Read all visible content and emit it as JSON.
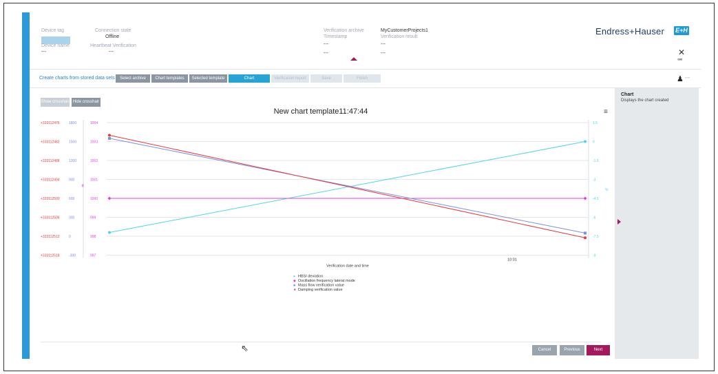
{
  "header": {
    "device_tag_label": "Device tag",
    "device_name_label": "Device name",
    "device_name_value": "---",
    "connection_state_label": "Connection state",
    "connection_state_value": "Offline",
    "heartbeat_label": "Heartbeat Verification",
    "heartbeat_value": "---",
    "verification_archive_label": "Verification archive",
    "verification_archive_value": "MyCustomerProjects1",
    "timestamp_label": "Timestamp",
    "timestamp_value": "---",
    "verification_result_label": "Verification result",
    "verification_result_value": "---",
    "extra_value_1": "---",
    "extra_value_2": "---",
    "brand": "Endress+Hauser",
    "brand_logo": "E+H"
  },
  "wizard": {
    "title": "Create charts from stored data sets",
    "steps": [
      {
        "label": "Select archive",
        "state": "done"
      },
      {
        "label": "Chart templates",
        "state": "done"
      },
      {
        "label": "Selected template",
        "state": "done"
      },
      {
        "label": "Chart",
        "state": "active"
      },
      {
        "label": "Verification report",
        "state": "todo"
      },
      {
        "label": "Save",
        "state": "todo"
      },
      {
        "label": "Finish",
        "state": "todo"
      }
    ],
    "user_dots": "---"
  },
  "toolbar": {
    "show_crosshair": "Show crosshair",
    "hide_crosshair": "Hide crosshair"
  },
  "side_panel": {
    "title": "Chart",
    "description": "Displays the chart created"
  },
  "footer": {
    "cancel": "Cancel",
    "previous": "Previous",
    "next": "Next"
  },
  "colors": {
    "accent_blue": "#2c9ad8",
    "brand_magenta": "#a3195b",
    "series_cyan": "#4fd6e6",
    "series_magenta": "#e040e0",
    "series_blue": "#7b8fe0",
    "series_red": "#e8383e"
  },
  "chart_data": {
    "type": "line",
    "title": "New chart template11:47:44",
    "xlabel": "Verification date and time",
    "x_tick_label": "10:01",
    "axes": [
      {
        "side": "left",
        "color": "#e8383e",
        "ticks": [
          "+333112476",
          "+333112482",
          "+333112488",
          "+333112494",
          "+333112500",
          "+333112506",
          "+333112512",
          "+333112518"
        ]
      },
      {
        "side": "left",
        "color": "#7b8fe0",
        "label": "ft",
        "ticks": [
          "1800",
          "1500",
          "1200",
          "900",
          "600",
          "300",
          "0",
          "-300"
        ]
      },
      {
        "side": "left",
        "color": "#e040e0",
        "label": "ft",
        "ticks": [
          "1004",
          "1003",
          "1002",
          "1001",
          "1000",
          "999",
          "998",
          "997"
        ]
      },
      {
        "side": "right",
        "color": "#4fd6e6",
        "label": "%",
        "ticks": [
          "1.5",
          "0",
          "-1.5",
          "-3",
          "-4.5",
          "-6",
          "-7.5",
          "-9"
        ]
      }
    ],
    "series": [
      {
        "name": "HBSI deviation",
        "color": "#4fd6e6",
        "marker": "circle",
        "axis": 3,
        "points": [
          [
            "start",
            -7.2
          ],
          [
            "end",
            0
          ]
        ]
      },
      {
        "name": "Oscillation frequency lateral mode",
        "color": "#e040e0",
        "marker": "diamond",
        "axis": 2,
        "points": [
          [
            "start",
            1000
          ],
          [
            "end",
            1000
          ]
        ]
      },
      {
        "name": "Mass flow verification value",
        "color": "#7b8fe0",
        "marker": "square",
        "axis": 1,
        "points": [
          [
            "start",
            1550
          ],
          [
            "end",
            50
          ]
        ]
      },
      {
        "name": "Damping verification value",
        "color": "#e8383e",
        "marker": "star",
        "axis": 0,
        "points": [
          [
            "start",
            333112480
          ],
          [
            "end",
            333112512.5
          ]
        ]
      }
    ],
    "legend_position": "bottom-center",
    "grid": true
  }
}
